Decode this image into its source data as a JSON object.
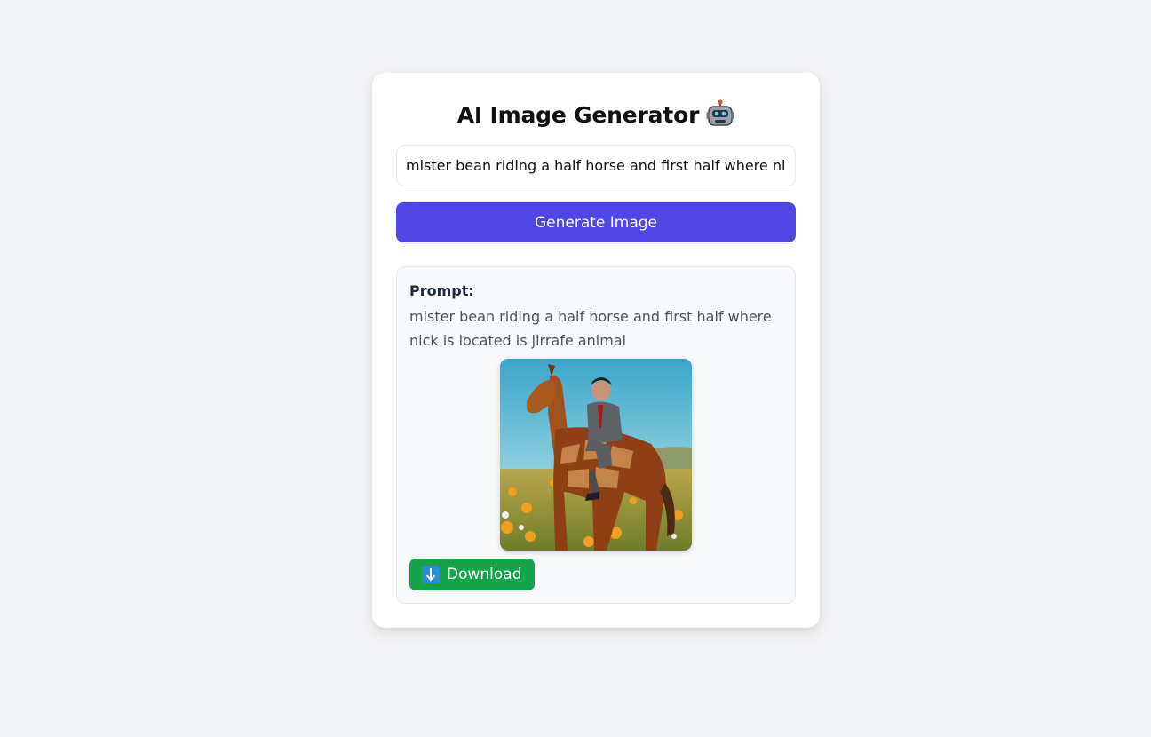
{
  "app": {
    "title": "AI Image Generator",
    "title_icon": "robot-icon"
  },
  "prompt_input": {
    "value": "mister bean riding a half horse and first half where nick is located is jirrafe animal"
  },
  "generate_button": {
    "label": "Generate Image",
    "color": "#4f46e5"
  },
  "result": {
    "prompt_label": "Prompt:",
    "prompt_text": "mister bean riding a half horse and first half where nick is located is jirrafe animal",
    "image_icon": "generated-image",
    "download_label": "Download",
    "download_icon": "down-arrow-icon",
    "download_color": "#16a34a"
  }
}
